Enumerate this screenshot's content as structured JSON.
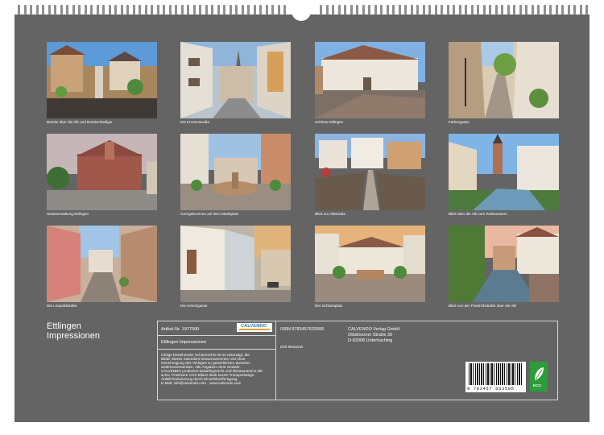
{
  "photos": [
    {
      "caption": "Brücke über die Alb und Brückenheiliger"
    },
    {
      "caption": "Die Kronenstraße"
    },
    {
      "caption": "Schloss Ettlingen"
    },
    {
      "caption": "Färbergasse"
    },
    {
      "caption": "Stadtverwaltung Ettlingen"
    },
    {
      "caption": "Georgsbrunnen auf dem Marktplatz"
    },
    {
      "caption": "Blick zur Albstraße"
    },
    {
      "caption": "Blick über die Alb zum Rathausturm"
    },
    {
      "caption": "Die Leopoldstraße"
    },
    {
      "caption": "Die Hirschgasse"
    },
    {
      "caption": "Der Schlossplatz"
    },
    {
      "caption": "Blick von der Friedrichstraße über die Alb"
    }
  ],
  "title_line1": "Ettlingen",
  "title_line2": "Impressionen",
  "info": {
    "article": "Artikel-Nr. 1977090",
    "calvendo_logo": "CALVENDO",
    "product_title": "Ettlingen Impressionen",
    "legal": [
      "Infolge bestehender Schutzrechte ist es untersagt, die",
      "Bilder dieses Kalenders herauszutrennen und ohne",
      "Genehmigung des Verlages zu gewerblichen Zwecken",
      "weiterzuverwenden. Alle Angaben ohne Gewähr.",
      "CALVENDO produziert bedarfsgerecht und klimaneutral in DE",
      "& EU. Positivere CO2-Bilanz dank kurzer Transportwege.",
      "Abfall-Reduzierung durch Einzelstückfertigung.",
      "E-Mail: info@calvendo.com · www.calvendo.com"
    ],
    "isbn": "ISBN 9783457633595",
    "author": "Dirk Meutzner",
    "publisher_name": "CALVENDO Verlag GmbH",
    "publisher_street": "Ottobrunner Straße 39",
    "publisher_city": "D-82008 Unterhaching",
    "barcode_number": "9 783457 633595",
    "eco_label": "ECO"
  }
}
